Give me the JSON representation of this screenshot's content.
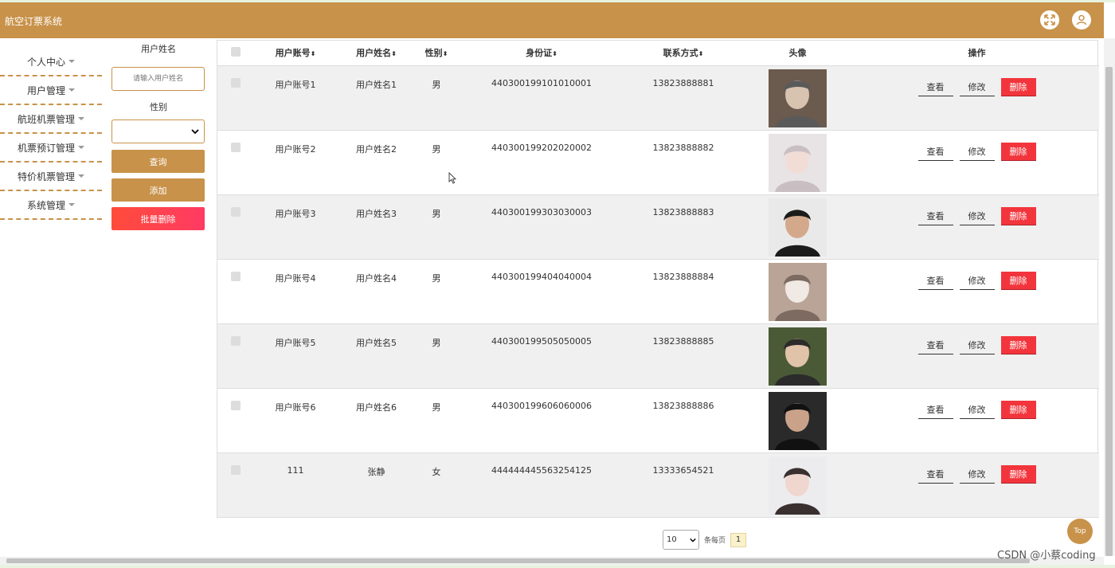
{
  "header": {
    "title": "航空订票系统",
    "fullscreen_icon": "fullscreen-icon",
    "user_icon": "user-icon",
    "color": "#c8924a"
  },
  "sidebar": {
    "items": [
      {
        "label": "个人中心"
      },
      {
        "label": "用户管理"
      },
      {
        "label": "航班机票管理"
      },
      {
        "label": "机票预订管理"
      },
      {
        "label": "特价机票管理"
      },
      {
        "label": "系统管理"
      }
    ]
  },
  "filter": {
    "name_label": "用户姓名",
    "name_placeholder": "请输入用户姓名",
    "gender_label": "性别",
    "gender_value": "",
    "query_label": "查询",
    "add_label": "添加",
    "batch_delete_label": "批量删除"
  },
  "table": {
    "columns": {
      "account": "用户账号",
      "name": "用户姓名",
      "gender": "性别",
      "id_card": "身份证",
      "phone": "联系方式",
      "avatar": "头像",
      "actions": "操作"
    },
    "sort_glyph": "⬍",
    "actions": {
      "view": "查看",
      "edit": "修改",
      "delete": "删除"
    },
    "rows": [
      {
        "account": "用户账号1",
        "name": "用户姓名1",
        "gender": "男",
        "id_card": "440300199101010001",
        "phone": "13823888881",
        "avatar": "avatar-photo"
      },
      {
        "account": "用户账号2",
        "name": "用户姓名2",
        "gender": "男",
        "id_card": "440300199202020002",
        "phone": "13823888882",
        "avatar": "avatar-photo"
      },
      {
        "account": "用户账号3",
        "name": "用户姓名3",
        "gender": "男",
        "id_card": "440300199303030003",
        "phone": "13823888883",
        "avatar": "avatar-photo"
      },
      {
        "account": "用户账号4",
        "name": "用户姓名4",
        "gender": "男",
        "id_card": "440300199404040004",
        "phone": "13823888884",
        "avatar": "avatar-photo"
      },
      {
        "account": "用户账号5",
        "name": "用户姓名5",
        "gender": "男",
        "id_card": "440300199505050005",
        "phone": "13823888885",
        "avatar": "avatar-photo"
      },
      {
        "account": "用户账号6",
        "name": "用户姓名6",
        "gender": "男",
        "id_card": "440300199606060006",
        "phone": "13823888886",
        "avatar": "avatar-photo"
      },
      {
        "account": "111",
        "name": "张静",
        "gender": "女",
        "id_card": "444444445563254125",
        "phone": "13333654521",
        "avatar": "avatar-photo"
      }
    ]
  },
  "pagination": {
    "page_size": "10",
    "per_page_label": "条每页",
    "current_page": "1"
  },
  "top_button": "Top",
  "watermark": "CSDN @小蔡coding"
}
